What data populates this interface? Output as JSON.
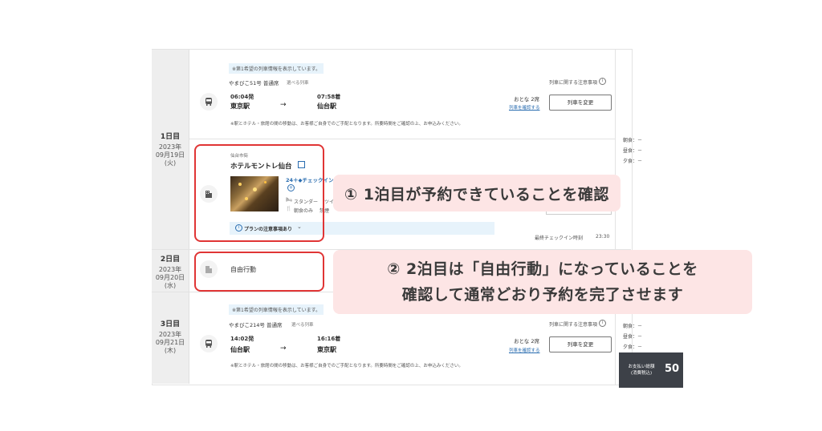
{
  "days": [
    {
      "label": "1日目",
      "year": "2023年",
      "date": "09月19日",
      "weekday": "(火)"
    },
    {
      "label": "2日目",
      "year": "2023年",
      "date": "09月20日",
      "weekday": "(水)"
    },
    {
      "label": "3日目",
      "year": "2023年",
      "date": "09月21日",
      "weekday": "(木)"
    }
  ],
  "train1": {
    "note": "※第1希望の列車情報を表示しています。",
    "name": "やまびこ51号 普通席",
    "choose": "選べる列車",
    "caution": "列車に関する注意事項",
    "dep_time": "06:04発",
    "dep_station": "東京駅",
    "arr_time": "07:58着",
    "arr_station": "仙台駅",
    "arrow": "→",
    "pax": "おとな 2席",
    "confirm": "列車を確認する",
    "change": "列車を変更",
    "footnote": "※駅とホテル・旅館の間の移動は、お客様ご自身でのご手配となります。所要時間をご確認の上、お申込みください。"
  },
  "hotel": {
    "area": "仙台市街",
    "name": "ホテルモントレ仙台",
    "checkin": "24＋◆チェックイン",
    "room": "スタンダー",
    "room2": "ツイン",
    "meal": "朝食のみ",
    "meal2": "禁煙",
    "plan_note": "プランの注意事項あり",
    "last_checkin": "最終チェックイン時刻",
    "last_checkin_time": "23:30"
  },
  "meals1": [
    "朝食：－",
    "昼食：－",
    "夕食：－"
  ],
  "free": {
    "label": "自由行動"
  },
  "train2": {
    "note": "※第1希望の列車情報を表示しています。",
    "name": "やまびこ214号 普通席",
    "choose": "選べる列車",
    "caution": "列車に関する注意事項",
    "dep_time": "14:02発",
    "dep_station": "仙台駅",
    "arr_time": "16:16着",
    "arr_station": "東京駅",
    "arrow": "→",
    "pax": "おとな 2席",
    "confirm": "列車を確認する",
    "change": "列車を変更",
    "footnote": "※駅とホテル・旅館の間の移動は、お客様ご自身でのご手配となります。所要時間をご確認の上、お申込みください。"
  },
  "meals3": [
    "朝食：－",
    "昼食：－",
    "夕食：－"
  ],
  "total": {
    "label1": "お支払い総額",
    "label2": "(消費税込)",
    "amount": "50"
  },
  "callouts": {
    "one": "① 1泊目が予約できていることを確認",
    "two_line1": "② 2泊目は「自由行動」になっていることを",
    "two_line2": "確認して通常どおり予約を完了させます"
  },
  "colors": {
    "accent_red": "#e03535",
    "callout_bg": "#fde5e5",
    "link_blue": "#2a6db0",
    "note_bg": "#e7f3fb"
  }
}
